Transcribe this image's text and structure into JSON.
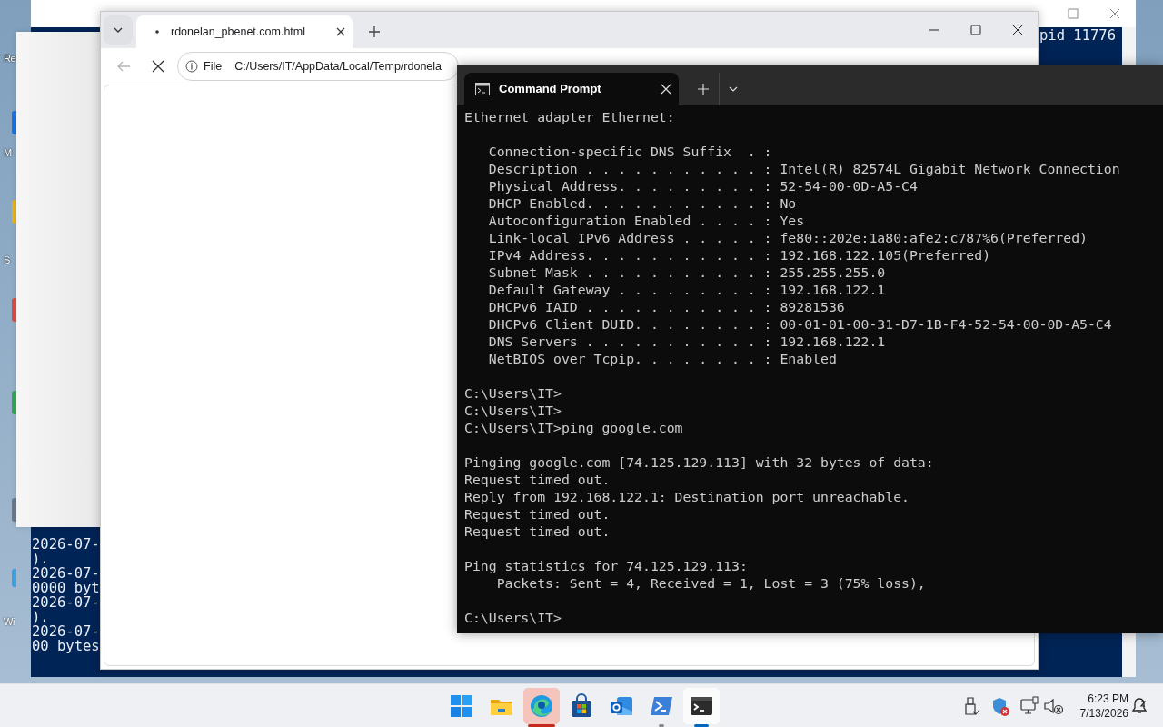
{
  "desktop": {
    "icon_labels": [
      "Re",
      "M",
      "S",
      "Wi"
    ]
  },
  "background_window": {
    "top_text": "pid 11776",
    "bottom_lines": [
      "2026-07-",
      ").",
      "2026-07-",
      "0000 byt",
      "2026-07-",
      ").",
      "2026-07-",
      "00 bytes"
    ]
  },
  "browser": {
    "tabs": [
      {
        "title": "rdonelan_pbenet.com.html",
        "selected": true,
        "loading": true
      }
    ],
    "back_disabled": true,
    "address": {
      "scheme_label": "File",
      "url": "C:/Users/IT/AppData/Local/Temp/rdonela"
    }
  },
  "terminal": {
    "tabs": [
      {
        "title": "Command Prompt",
        "selected": true
      }
    ],
    "blocks": [
      [
        "Ethernet adapter Ethernet:"
      ],
      [
        "   Connection-specific DNS Suffix  . :",
        "   Description . . . . . . . . . . . : Intel(R) 82574L Gigabit Network Connection",
        "   Physical Address. . . . . . . . . : 52-54-00-0D-A5-C4",
        "   DHCP Enabled. . . . . . . . . . . : No",
        "   Autoconfiguration Enabled . . . . : Yes",
        "   Link-local IPv6 Address . . . . . : fe80::202e:1a80:afe2:c787%6(Preferred)",
        "   IPv4 Address. . . . . . . . . . . : 192.168.122.105(Preferred)",
        "   Subnet Mask . . . . . . . . . . . : 255.255.255.0",
        "   Default Gateway . . . . . . . . . : 192.168.122.1",
        "   DHCPv6 IAID . . . . . . . . . . . : 89281536",
        "   DHCPv6 Client DUID. . . . . . . . : 00-01-01-00-31-D7-1B-F4-52-54-00-0D-A5-C4",
        "   DNS Servers . . . . . . . . . . . : 192.168.122.1",
        "   NetBIOS over Tcpip. . . . . . . . : Enabled"
      ],
      [
        "C:\\Users\\IT>",
        "C:\\Users\\IT>",
        "C:\\Users\\IT>ping google.com"
      ],
      [
        "Pinging google.com [74.125.129.113] with 32 bytes of data:",
        "Request timed out.",
        "Reply from 192.168.122.1: Destination port unreachable.",
        "Request timed out.",
        "Request timed out."
      ],
      [
        "Ping statistics for 74.125.129.113:",
        "    Packets: Sent = 4, Received = 1, Lost = 3 (75% loss),"
      ],
      [
        "C:\\Users\\IT>"
      ]
    ]
  },
  "taskbar": {
    "apps": [
      {
        "kind": "start",
        "running": false,
        "active": false,
        "attention": false
      },
      {
        "kind": "folder",
        "running": false,
        "active": false,
        "attention": false
      },
      {
        "kind": "browser",
        "running": true,
        "active": false,
        "attention": true
      },
      {
        "kind": "store",
        "running": false,
        "active": false,
        "attention": false
      },
      {
        "kind": "mail",
        "running": false,
        "active": false,
        "attention": false
      },
      {
        "kind": "shell",
        "running": true,
        "active": false,
        "attention": false
      },
      {
        "kind": "terminal",
        "running": true,
        "active": true,
        "attention": false
      }
    ],
    "tray": [
      {
        "kind": "usb"
      },
      {
        "kind": "shield"
      },
      {
        "kind": "network"
      },
      {
        "kind": "volume"
      }
    ],
    "clock": {
      "time": "6:23 PM",
      "date": "7/13/2026"
    }
  }
}
